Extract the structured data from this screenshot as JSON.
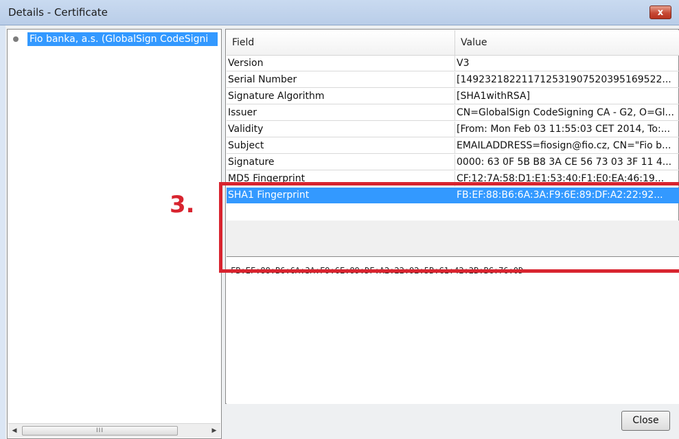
{
  "window": {
    "title": "Details - Certificate",
    "close_glyph": "x"
  },
  "tree": {
    "node_label": "Fio banka, a.s. (GlobalSign CodeSigni",
    "scroll_thumb_grip": "III",
    "scroll_left": "◀",
    "scroll_right": "▶"
  },
  "table": {
    "headers": {
      "field": "Field",
      "value": "Value"
    },
    "rows": [
      {
        "field": "Version",
        "value": "V3"
      },
      {
        "field": "Serial Number",
        "value": "[149232182211712531907520395169522..."
      },
      {
        "field": "Signature Algorithm",
        "value": "[SHA1withRSA]"
      },
      {
        "field": "Issuer",
        "value": "CN=GlobalSign CodeSigning CA - G2, O=Gl..."
      },
      {
        "field": "Validity",
        "value": "[From: Mon Feb 03 11:55:03 CET 2014, To:..."
      },
      {
        "field": "Subject",
        "value": "EMAILADDRESS=fiosign@fio.cz, CN=\"Fio b..."
      },
      {
        "field": "Signature",
        "value": "0000: 63 0F 5B B8 3A CE 56 73  03 3F 11 4..."
      },
      {
        "field": "MD5 Fingerprint",
        "value": "CF:12:7A:58:D1:E1:53:40:F1:E0:EA:46:19..."
      },
      {
        "field": "SHA1 Fingerprint",
        "value": "FB:EF:88:B6:6A:3A:F9:6E:89:DF:A2:22:92..."
      }
    ],
    "selected_index": 8
  },
  "detail": {
    "text": "FB:EF:88:B6:6A:3A:F9:6E:89:DF:A2:22:92:5B:C1:42:2B:BC:76:0D"
  },
  "annotation": {
    "step": "3.",
    "color": "#d8242f"
  },
  "buttons": {
    "close": "Close"
  },
  "colors": {
    "selection": "#3399ff",
    "titlebar": "#c9daf0"
  }
}
